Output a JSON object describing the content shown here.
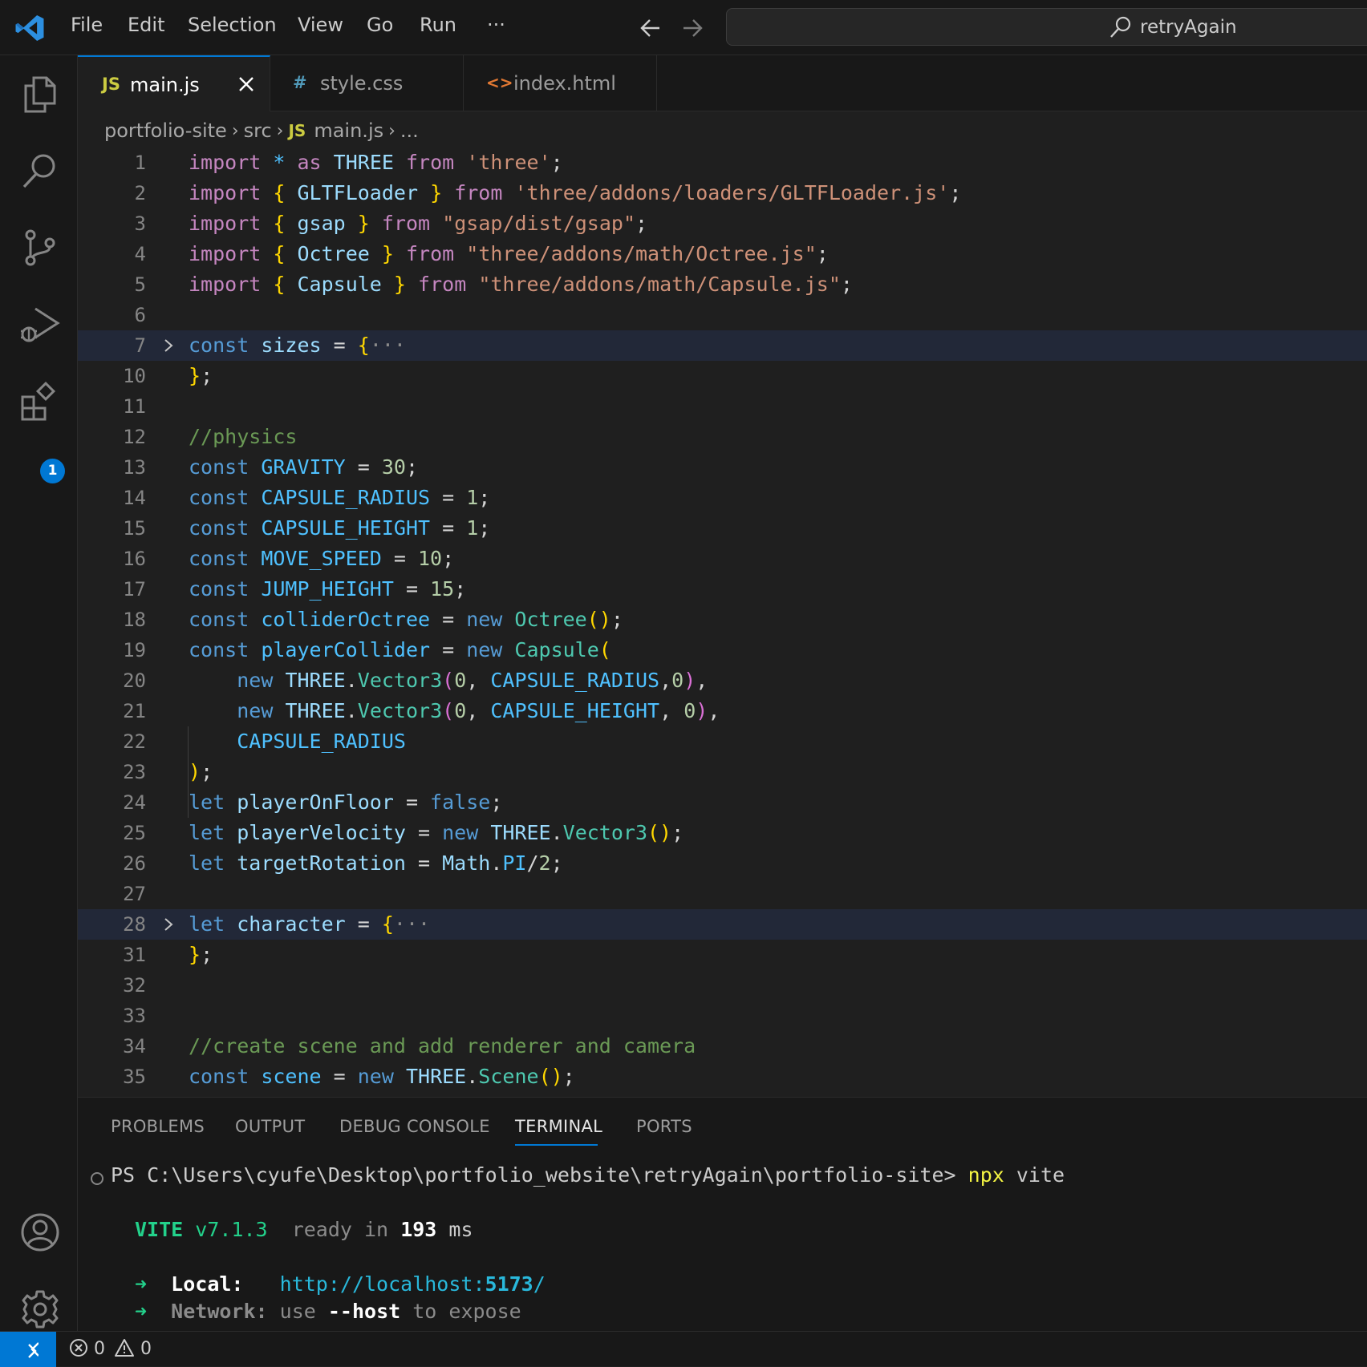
{
  "titlebar": {
    "menu": [
      "File",
      "Edit",
      "Selection",
      "View",
      "Go",
      "Run",
      "···"
    ],
    "search_text": "retryAgain"
  },
  "activity_bar": {
    "icons": [
      "explorer-icon",
      "search-icon",
      "source-control-icon",
      "run-debug-icon",
      "extensions-icon",
      "account-icon",
      "settings-gear-icon"
    ],
    "extensions_badge": "1"
  },
  "tabs": [
    {
      "icon": "JS",
      "label": "main.js",
      "active": true,
      "icon_color": "#cbcb41"
    },
    {
      "icon": "#",
      "label": "style.css",
      "active": false,
      "icon_color": "#519aba"
    },
    {
      "icon": "<>",
      "label": "index.html",
      "active": false,
      "icon_color": "#e37933"
    }
  ],
  "breadcrumb": {
    "project": "portfolio-site",
    "folder": "src",
    "file_icon": "JS",
    "file": "main.js",
    "more": "..."
  },
  "editor": {
    "lines": [
      {
        "n": "1",
        "html": "<span class='ctl'>import</span> <span class='cst'>*</span> <span class='ctl'>as</span> <span class='var'>THREE</span> <span class='ctl'>from</span> <span class='str'>'three'</span>;"
      },
      {
        "n": "2",
        "html": "<span class='ctl'>import</span> <span class='br1'>{</span> <span class='var'>GLTFLoader</span> <span class='br1'>}</span> <span class='ctl'>from</span> <span class='str'>'three/addons/loaders/GLTFLoader.js'</span>;"
      },
      {
        "n": "3",
        "html": "<span class='ctl'>import</span> <span class='br1'>{</span> <span class='var'>gsap</span> <span class='br1'>}</span> <span class='ctl'>from</span> <span class='str'>\"gsap/dist/gsap\"</span>;"
      },
      {
        "n": "4",
        "html": "<span class='ctl'>import</span> <span class='br1'>{</span> <span class='var'>Octree</span> <span class='br1'>}</span> <span class='ctl'>from</span> <span class='str'>\"three/addons/math/Octree.js\"</span>;"
      },
      {
        "n": "5",
        "html": "<span class='ctl'>import</span> <span class='br1'>{</span> <span class='var'>Capsule</span> <span class='br1'>}</span> <span class='ctl'>from</span> <span class='str'>\"three/addons/math/Capsule.js\"</span>;"
      },
      {
        "n": "6",
        "html": ""
      },
      {
        "n": "7",
        "html": "<span class='kw'>const</span> <span class='var'>sizes</span> = <span class='br1'>{</span><span class='fold-dots'>···</span>",
        "fold": true,
        "hl": true
      },
      {
        "n": "10",
        "html": "<span class='br1'>}</span>;"
      },
      {
        "n": "11",
        "html": ""
      },
      {
        "n": "12",
        "html": "<span class='cmt'>//physics</span>"
      },
      {
        "n": "13",
        "html": "<span class='kw'>const</span> <span class='cst'>GRAVITY</span> = <span class='num'>30</span>;"
      },
      {
        "n": "14",
        "html": "<span class='kw'>const</span> <span class='cst'>CAPSULE_RADIUS</span> = <span class='num'>1</span>;"
      },
      {
        "n": "15",
        "html": "<span class='kw'>const</span> <span class='cst'>CAPSULE_HEIGHT</span> = <span class='num'>1</span>;"
      },
      {
        "n": "16",
        "html": "<span class='kw'>const</span> <span class='cst'>MOVE_SPEED</span> = <span class='num'>10</span>;"
      },
      {
        "n": "17",
        "html": "<span class='kw'>const</span> <span class='cst'>JUMP_HEIGHT</span> = <span class='num'>15</span>;"
      },
      {
        "n": "18",
        "html": "<span class='kw'>const</span> <span class='cst'>colliderOctree</span> = <span class='kw'>new</span> <span class='cls'>Octree</span><span class='br1'>()</span>;"
      },
      {
        "n": "19",
        "html": "<span class='kw'>const</span> <span class='cst'>playerCollider</span> = <span class='kw'>new</span> <span class='cls'>Capsule</span><span class='br1'>(</span>"
      },
      {
        "n": "20",
        "html": "    <span class='kw'>new</span> <span class='var'>THREE</span>.<span class='cls'>Vector3</span><span class='br2'>(</span><span class='num'>0</span>, <span class='cst'>CAPSULE_RADIUS</span>,<span class='num'>0</span><span class='br2'>)</span>,"
      },
      {
        "n": "21",
        "html": "    <span class='kw'>new</span> <span class='var'>THREE</span>.<span class='cls'>Vector3</span><span class='br2'>(</span><span class='num'>0</span>, <span class='cst'>CAPSULE_HEIGHT</span>, <span class='num'>0</span><span class='br2'>)</span>,"
      },
      {
        "n": "22",
        "html": "    <span class='cst'>CAPSULE_RADIUS</span>"
      },
      {
        "n": "23",
        "html": "<span class='br1'>)</span>;"
      },
      {
        "n": "24",
        "html": "<span class='kw'>let</span> <span class='var'>playerOnFloor</span> = <span class='kw'>false</span>;"
      },
      {
        "n": "25",
        "html": "<span class='kw'>let</span> <span class='var'>playerVelocity</span> = <span class='kw'>new</span> <span class='var'>THREE</span>.<span class='cls'>Vector3</span><span class='br1'>()</span>;"
      },
      {
        "n": "26",
        "html": "<span class='kw'>let</span> <span class='var'>targetRotation</span> = <span class='var'>Math</span>.<span class='cst'>PI</span>/<span class='num'>2</span>;"
      },
      {
        "n": "27",
        "html": ""
      },
      {
        "n": "28",
        "html": "<span class='kw'>let</span> <span class='var'>character</span> = <span class='br1'>{</span><span class='fold-dots'>···</span>",
        "fold": true,
        "hl": true
      },
      {
        "n": "31",
        "html": "<span class='br1'>}</span>;"
      },
      {
        "n": "32",
        "html": ""
      },
      {
        "n": "33",
        "html": ""
      },
      {
        "n": "34",
        "html": "<span class='cmt'>//create scene and add renderer and camera</span>"
      },
      {
        "n": "35",
        "html": "<span class='kw'>const</span> <span class='cst'>scene</span> = <span class='kw'>new</span> <span class='var'>THREE</span>.<span class='cls'>Scene</span><span class='br1'>()</span>;"
      }
    ]
  },
  "panel": {
    "tabs": [
      "PROBLEMS",
      "OUTPUT",
      "DEBUG CONSOLE",
      "TERMINAL",
      "PORTS"
    ],
    "active_tab": "TERMINAL",
    "terminal": {
      "prompt": "PS C:\\Users\\cyufe\\Desktop\\portfolio_website\\retryAgain\\portfolio-site>",
      "command": "npx",
      "command_arg": "vite",
      "vite_name": "VITE",
      "vite_version": "v7.1.3",
      "ready_text": "ready in",
      "ready_ms": "193",
      "ready_unit": "ms",
      "arrow": "➜",
      "local_label": "Local:",
      "local_url_prefix": "http://localhost:",
      "local_port": "5173",
      "local_url_suffix": "/",
      "network_label": "Network:",
      "network_text_1": "use",
      "network_flag": "--host",
      "network_text_2": "to expose"
    }
  },
  "statusbar": {
    "errors": "0",
    "warnings": "0"
  },
  "colors": {
    "accent": "#0078d4",
    "background": "#1f1f1f",
    "chrome": "#181818"
  }
}
